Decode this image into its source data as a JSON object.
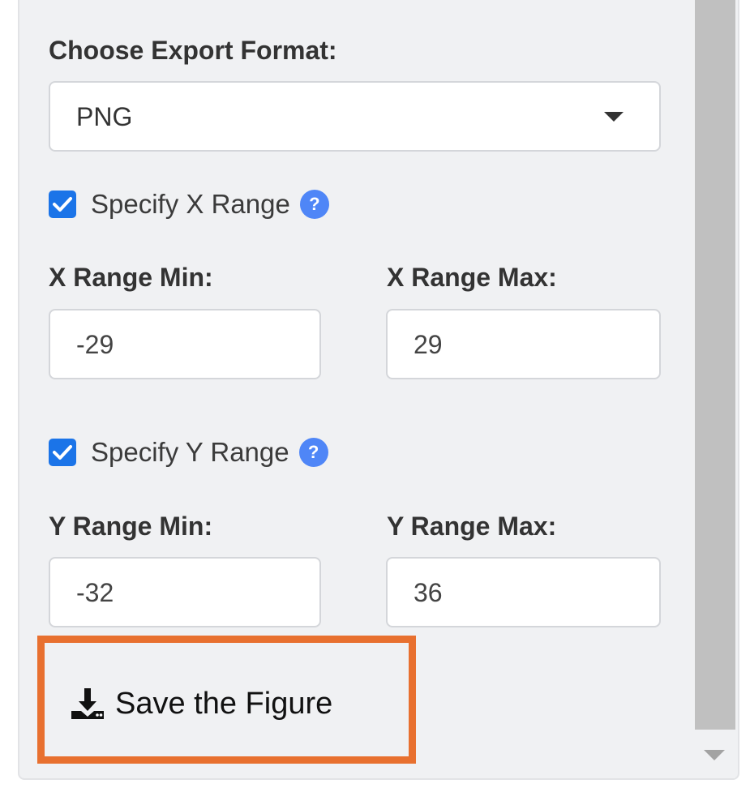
{
  "export": {
    "format_label": "Choose Export Format:",
    "format_value": "PNG"
  },
  "x_range": {
    "checkbox_label": "Specify X Range",
    "checked": true,
    "help_icon": "?",
    "min_label": "X Range Min:",
    "min_value": "-29",
    "max_label": "X Range Max:",
    "max_value": "29"
  },
  "y_range": {
    "checkbox_label": "Specify Y Range",
    "checked": true,
    "help_icon": "?",
    "min_label": "Y Range Min:",
    "min_value": "-32",
    "max_label": "Y Range Max:",
    "max_value": "36"
  },
  "save_button": {
    "label": "Save the Figure",
    "icon": "download-icon"
  },
  "colors": {
    "checkbox": "#1b74e8",
    "help_icon": "#4f86f7",
    "highlight": "#e8702f",
    "panel_bg": "#f0f1f3"
  }
}
